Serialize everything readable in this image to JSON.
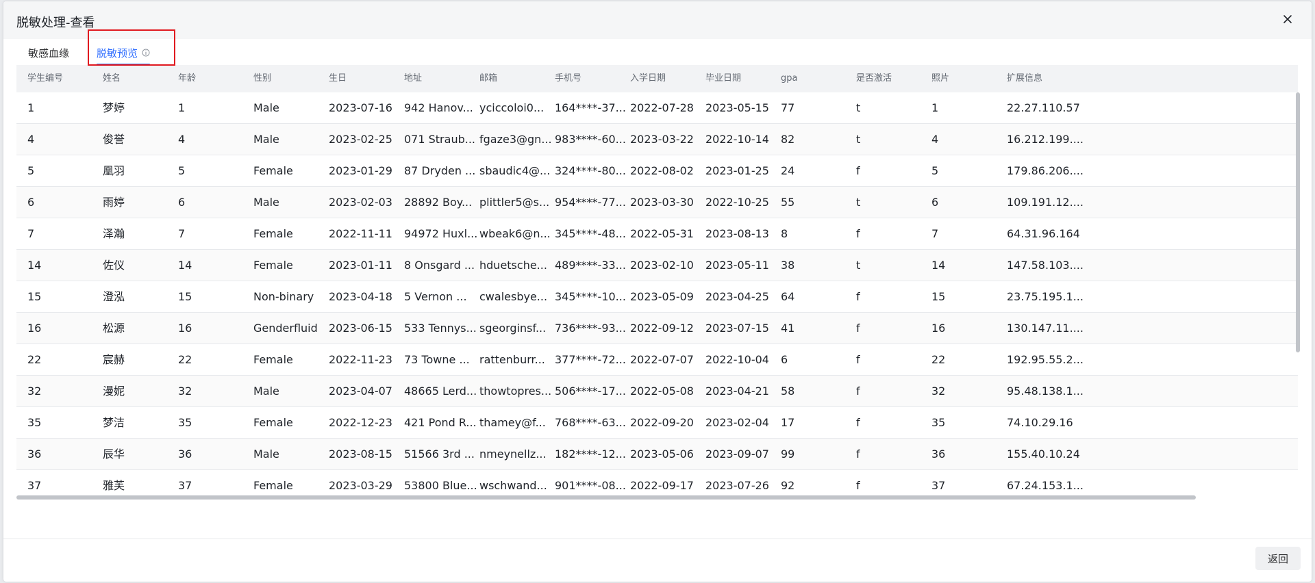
{
  "dialog": {
    "title": "脱敏处理-查看",
    "back_label": "返回"
  },
  "tabs": [
    {
      "label": "敏感血缘",
      "active": false
    },
    {
      "label": "脱敏预览",
      "active": true
    }
  ],
  "colors": {
    "accent": "#3370ff",
    "highlight": "#e0191f",
    "header_bg": "#f2f3f5"
  },
  "table": {
    "columns": [
      "学生编号",
      "姓名",
      "年龄",
      "性别",
      "生日",
      "地址",
      "邮箱",
      "手机号",
      "入学日期",
      "毕业日期",
      "gpa",
      "是否激活",
      "照片",
      "扩展信息"
    ],
    "rows": [
      [
        "1",
        "梦婷",
        "1",
        "Male",
        "2023-07-16",
        "942 Hanov...",
        "yciccoloi0...",
        "164****-37...",
        "2022-07-28",
        "2023-05-15",
        "77",
        "t",
        "1",
        "22.27.110.57"
      ],
      [
        "4",
        "俊誉",
        "4",
        "Male",
        "2023-02-25",
        "071 Straub...",
        "fgaze3@gn...",
        "983****-60...",
        "2023-03-22",
        "2022-10-14",
        "82",
        "t",
        "4",
        "16.212.199...."
      ],
      [
        "5",
        "凰羽",
        "5",
        "Female",
        "2023-01-29",
        "87 Dryden ...",
        "sbaudic4@...",
        "324****-80...",
        "2022-08-02",
        "2023-01-25",
        "24",
        "f",
        "5",
        "179.86.206...."
      ],
      [
        "6",
        "雨婷",
        "6",
        "Male",
        "2023-02-03",
        "28892 Boy...",
        "plittler5@s...",
        "954****-77...",
        "2023-03-30",
        "2022-10-25",
        "55",
        "t",
        "6",
        "109.191.12...."
      ],
      [
        "7",
        "泽瀚",
        "7",
        "Female",
        "2022-11-11",
        "94972 Huxl...",
        "wbeak6@n...",
        "345****-48...",
        "2022-05-31",
        "2023-08-13",
        "8",
        "f",
        "7",
        "64.31.96.164"
      ],
      [
        "14",
        "佐仪",
        "14",
        "Female",
        "2023-01-11",
        "8 Onsgard ...",
        "hduetsche...",
        "489****-33...",
        "2023-02-10",
        "2023-05-11",
        "38",
        "t",
        "14",
        "147.58.103...."
      ],
      [
        "15",
        "澄泓",
        "15",
        "Non-binary",
        "2023-04-18",
        "5 Vernon ...",
        "cwalesbye...",
        "345****-10...",
        "2023-05-09",
        "2023-04-25",
        "64",
        "f",
        "15",
        "23.75.195.1..."
      ],
      [
        "16",
        "松源",
        "16",
        "Genderfluid",
        "2023-06-15",
        "533 Tennys...",
        "sgeorginsf...",
        "736****-93...",
        "2022-09-12",
        "2023-07-15",
        "41",
        "f",
        "16",
        "130.147.11...."
      ],
      [
        "22",
        "宸赫",
        "22",
        "Female",
        "2022-11-23",
        "73 Towne ...",
        "rattenburr...",
        "377****-72...",
        "2022-07-07",
        "2022-10-04",
        "6",
        "f",
        "22",
        "192.95.55.2..."
      ],
      [
        "32",
        "漫妮",
        "32",
        "Male",
        "2023-04-07",
        "48665 Lerd...",
        "thowtopres...",
        "506****-17...",
        "2022-05-08",
        "2023-04-21",
        "58",
        "f",
        "32",
        "95.48.138.1..."
      ],
      [
        "35",
        "梦洁",
        "35",
        "Female",
        "2022-12-23",
        "421 Pond R...",
        "thamey@f...",
        "768****-63...",
        "2022-09-20",
        "2023-02-04",
        "17",
        "f",
        "35",
        "74.10.29.16"
      ],
      [
        "36",
        "辰华",
        "36",
        "Male",
        "2023-08-15",
        "51566 3rd ...",
        "nmeynellz...",
        "182****-12...",
        "2023-05-06",
        "2023-09-07",
        "99",
        "f",
        "36",
        "155.40.10.24"
      ],
      [
        "37",
        "雅芙",
        "37",
        "Female",
        "2023-03-29",
        "53800 Blue...",
        "wschwand...",
        "901****-08...",
        "2022-09-17",
        "2023-07-26",
        "92",
        "f",
        "37",
        "67.24.153.1..."
      ]
    ]
  }
}
